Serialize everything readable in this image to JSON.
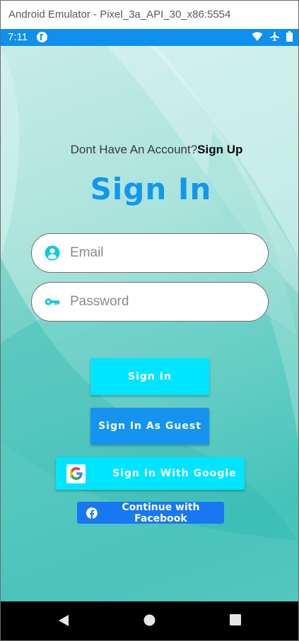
{
  "window": {
    "title": "Android Emulator - Pixel_3a_API_30_x86:5554"
  },
  "status_bar": {
    "time": "7:11",
    "icons": [
      "app-notification-icon",
      "wifi-icon",
      "airplane-mode-icon",
      "battery-icon"
    ]
  },
  "signup": {
    "prompt": "Dont Have An Account?",
    "link": "Sign Up"
  },
  "page": {
    "title": "Sign In"
  },
  "form": {
    "email": {
      "placeholder": "Email",
      "value": "",
      "icon": "person-circle-icon"
    },
    "password": {
      "placeholder": "Password",
      "value": "",
      "icon": "key-icon"
    }
  },
  "buttons": {
    "sign_in": "Sign In",
    "guest": "Sign In As Guest",
    "google": "Sign In With Google",
    "facebook": "Continue with Facebook"
  },
  "nav": {
    "icons": [
      "back-icon",
      "home-icon",
      "recents-icon"
    ]
  },
  "colors": {
    "status_bar": "#0f8fef",
    "title": "#1197ef",
    "sign_in_button": "#00e5ff",
    "guest_button": "#1593ef",
    "google_button": "#00e5ff",
    "facebook_button": "#1877f2"
  }
}
